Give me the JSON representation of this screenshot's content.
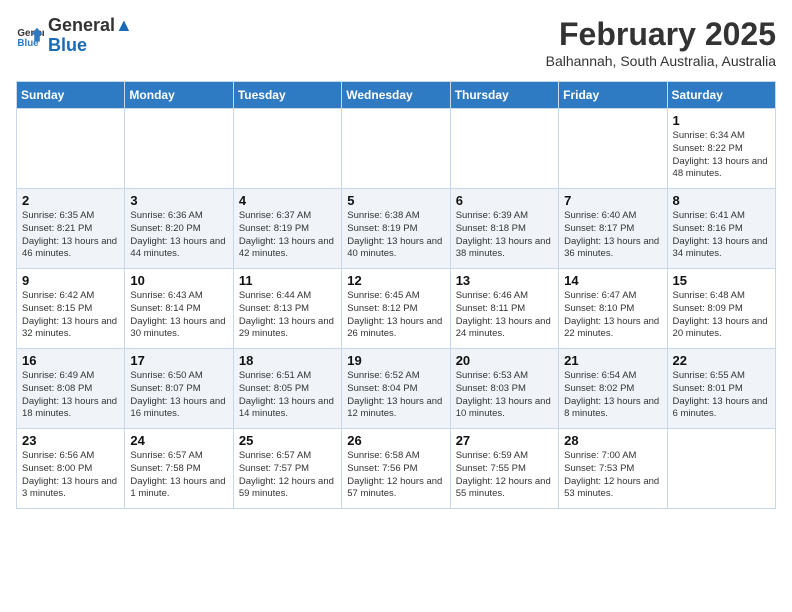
{
  "header": {
    "logo_general": "General",
    "logo_blue": "Blue",
    "month_title": "February 2025",
    "subtitle": "Balhannah, South Australia, Australia"
  },
  "days_of_week": [
    "Sunday",
    "Monday",
    "Tuesday",
    "Wednesday",
    "Thursday",
    "Friday",
    "Saturday"
  ],
  "weeks": [
    [
      {
        "day": "",
        "info": ""
      },
      {
        "day": "",
        "info": ""
      },
      {
        "day": "",
        "info": ""
      },
      {
        "day": "",
        "info": ""
      },
      {
        "day": "",
        "info": ""
      },
      {
        "day": "",
        "info": ""
      },
      {
        "day": "1",
        "info": "Sunrise: 6:34 AM\nSunset: 8:22 PM\nDaylight: 13 hours\nand 48 minutes."
      }
    ],
    [
      {
        "day": "2",
        "info": "Sunrise: 6:35 AM\nSunset: 8:21 PM\nDaylight: 13 hours\nand 46 minutes."
      },
      {
        "day": "3",
        "info": "Sunrise: 6:36 AM\nSunset: 8:20 PM\nDaylight: 13 hours\nand 44 minutes."
      },
      {
        "day": "4",
        "info": "Sunrise: 6:37 AM\nSunset: 8:19 PM\nDaylight: 13 hours\nand 42 minutes."
      },
      {
        "day": "5",
        "info": "Sunrise: 6:38 AM\nSunset: 8:19 PM\nDaylight: 13 hours\nand 40 minutes."
      },
      {
        "day": "6",
        "info": "Sunrise: 6:39 AM\nSunset: 8:18 PM\nDaylight: 13 hours\nand 38 minutes."
      },
      {
        "day": "7",
        "info": "Sunrise: 6:40 AM\nSunset: 8:17 PM\nDaylight: 13 hours\nand 36 minutes."
      },
      {
        "day": "8",
        "info": "Sunrise: 6:41 AM\nSunset: 8:16 PM\nDaylight: 13 hours\nand 34 minutes."
      }
    ],
    [
      {
        "day": "9",
        "info": "Sunrise: 6:42 AM\nSunset: 8:15 PM\nDaylight: 13 hours\nand 32 minutes."
      },
      {
        "day": "10",
        "info": "Sunrise: 6:43 AM\nSunset: 8:14 PM\nDaylight: 13 hours\nand 30 minutes."
      },
      {
        "day": "11",
        "info": "Sunrise: 6:44 AM\nSunset: 8:13 PM\nDaylight: 13 hours\nand 29 minutes."
      },
      {
        "day": "12",
        "info": "Sunrise: 6:45 AM\nSunset: 8:12 PM\nDaylight: 13 hours\nand 26 minutes."
      },
      {
        "day": "13",
        "info": "Sunrise: 6:46 AM\nSunset: 8:11 PM\nDaylight: 13 hours\nand 24 minutes."
      },
      {
        "day": "14",
        "info": "Sunrise: 6:47 AM\nSunset: 8:10 PM\nDaylight: 13 hours\nand 22 minutes."
      },
      {
        "day": "15",
        "info": "Sunrise: 6:48 AM\nSunset: 8:09 PM\nDaylight: 13 hours\nand 20 minutes."
      }
    ],
    [
      {
        "day": "16",
        "info": "Sunrise: 6:49 AM\nSunset: 8:08 PM\nDaylight: 13 hours\nand 18 minutes."
      },
      {
        "day": "17",
        "info": "Sunrise: 6:50 AM\nSunset: 8:07 PM\nDaylight: 13 hours\nand 16 minutes."
      },
      {
        "day": "18",
        "info": "Sunrise: 6:51 AM\nSunset: 8:05 PM\nDaylight: 13 hours\nand 14 minutes."
      },
      {
        "day": "19",
        "info": "Sunrise: 6:52 AM\nSunset: 8:04 PM\nDaylight: 13 hours\nand 12 minutes."
      },
      {
        "day": "20",
        "info": "Sunrise: 6:53 AM\nSunset: 8:03 PM\nDaylight: 13 hours\nand 10 minutes."
      },
      {
        "day": "21",
        "info": "Sunrise: 6:54 AM\nSunset: 8:02 PM\nDaylight: 13 hours\nand 8 minutes."
      },
      {
        "day": "22",
        "info": "Sunrise: 6:55 AM\nSunset: 8:01 PM\nDaylight: 13 hours\nand 6 minutes."
      }
    ],
    [
      {
        "day": "23",
        "info": "Sunrise: 6:56 AM\nSunset: 8:00 PM\nDaylight: 13 hours\nand 3 minutes."
      },
      {
        "day": "24",
        "info": "Sunrise: 6:57 AM\nSunset: 7:58 PM\nDaylight: 13 hours\nand 1 minute."
      },
      {
        "day": "25",
        "info": "Sunrise: 6:57 AM\nSunset: 7:57 PM\nDaylight: 12 hours\nand 59 minutes."
      },
      {
        "day": "26",
        "info": "Sunrise: 6:58 AM\nSunset: 7:56 PM\nDaylight: 12 hours\nand 57 minutes."
      },
      {
        "day": "27",
        "info": "Sunrise: 6:59 AM\nSunset: 7:55 PM\nDaylight: 12 hours\nand 55 minutes."
      },
      {
        "day": "28",
        "info": "Sunrise: 7:00 AM\nSunset: 7:53 PM\nDaylight: 12 hours\nand 53 minutes."
      },
      {
        "day": "",
        "info": ""
      }
    ]
  ]
}
